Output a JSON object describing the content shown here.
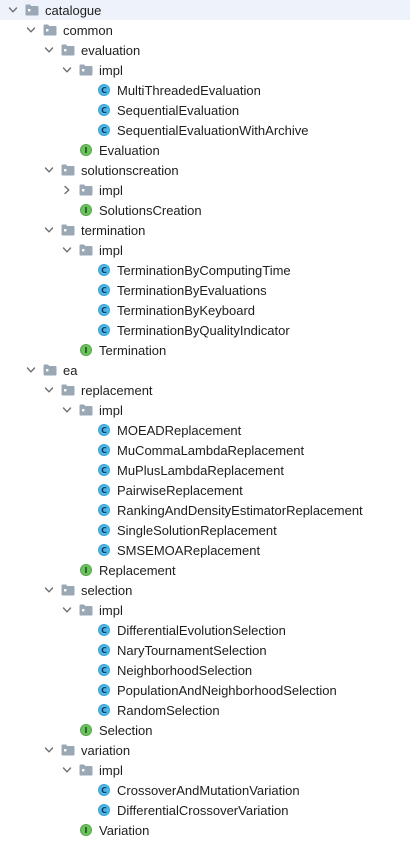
{
  "tree": [
    {
      "label": "catalogue",
      "depth": 0,
      "kind": "folder",
      "expanded": true
    },
    {
      "label": "common",
      "depth": 1,
      "kind": "folder",
      "expanded": true
    },
    {
      "label": "evaluation",
      "depth": 2,
      "kind": "folder",
      "expanded": true
    },
    {
      "label": "impl",
      "depth": 3,
      "kind": "folder",
      "expanded": true
    },
    {
      "label": "MultiThreadedEvaluation",
      "depth": 4,
      "kind": "class"
    },
    {
      "label": "SequentialEvaluation",
      "depth": 4,
      "kind": "class"
    },
    {
      "label": "SequentialEvaluationWithArchive",
      "depth": 4,
      "kind": "class"
    },
    {
      "label": "Evaluation",
      "depth": 3,
      "kind": "interface"
    },
    {
      "label": "solutionscreation",
      "depth": 2,
      "kind": "folder",
      "expanded": true
    },
    {
      "label": "impl",
      "depth": 3,
      "kind": "folder",
      "expanded": false
    },
    {
      "label": "SolutionsCreation",
      "depth": 3,
      "kind": "interface"
    },
    {
      "label": "termination",
      "depth": 2,
      "kind": "folder",
      "expanded": true
    },
    {
      "label": "impl",
      "depth": 3,
      "kind": "folder",
      "expanded": true
    },
    {
      "label": "TerminationByComputingTime",
      "depth": 4,
      "kind": "class"
    },
    {
      "label": "TerminationByEvaluations",
      "depth": 4,
      "kind": "class"
    },
    {
      "label": "TerminationByKeyboard",
      "depth": 4,
      "kind": "class"
    },
    {
      "label": "TerminationByQualityIndicator",
      "depth": 4,
      "kind": "class"
    },
    {
      "label": "Termination",
      "depth": 3,
      "kind": "interface"
    },
    {
      "label": "ea",
      "depth": 1,
      "kind": "folder",
      "expanded": true
    },
    {
      "label": "replacement",
      "depth": 2,
      "kind": "folder",
      "expanded": true
    },
    {
      "label": "impl",
      "depth": 3,
      "kind": "folder",
      "expanded": true
    },
    {
      "label": "MOEADReplacement",
      "depth": 4,
      "kind": "class"
    },
    {
      "label": "MuCommaLambdaReplacement",
      "depth": 4,
      "kind": "class"
    },
    {
      "label": "MuPlusLambdaReplacement",
      "depth": 4,
      "kind": "class"
    },
    {
      "label": "PairwiseReplacement",
      "depth": 4,
      "kind": "class"
    },
    {
      "label": "RankingAndDensityEstimatorReplacement",
      "depth": 4,
      "kind": "class"
    },
    {
      "label": "SingleSolutionReplacement",
      "depth": 4,
      "kind": "class"
    },
    {
      "label": "SMSEMOAReplacement",
      "depth": 4,
      "kind": "class"
    },
    {
      "label": "Replacement",
      "depth": 3,
      "kind": "interface"
    },
    {
      "label": "selection",
      "depth": 2,
      "kind": "folder",
      "expanded": true
    },
    {
      "label": "impl",
      "depth": 3,
      "kind": "folder",
      "expanded": true
    },
    {
      "label": "DifferentialEvolutionSelection",
      "depth": 4,
      "kind": "class"
    },
    {
      "label": "NaryTournamentSelection",
      "depth": 4,
      "kind": "class"
    },
    {
      "label": "NeighborhoodSelection",
      "depth": 4,
      "kind": "class"
    },
    {
      "label": "PopulationAndNeighborhoodSelection",
      "depth": 4,
      "kind": "class"
    },
    {
      "label": "RandomSelection",
      "depth": 4,
      "kind": "class"
    },
    {
      "label": "Selection",
      "depth": 3,
      "kind": "interface"
    },
    {
      "label": "variation",
      "depth": 2,
      "kind": "folder",
      "expanded": true
    },
    {
      "label": "impl",
      "depth": 3,
      "kind": "folder",
      "expanded": true
    },
    {
      "label": "CrossoverAndMutationVariation",
      "depth": 4,
      "kind": "class"
    },
    {
      "label": "DifferentialCrossoverVariation",
      "depth": 4,
      "kind": "class"
    },
    {
      "label": "Variation",
      "depth": 3,
      "kind": "interface"
    }
  ],
  "badges": {
    "class": "C",
    "interface": "I"
  },
  "icons": {
    "folder": "folder-icon",
    "class": "class-icon",
    "interface": "interface-icon",
    "expanded": "chevron-down-icon",
    "collapsed": "chevron-right-icon"
  },
  "colors": {
    "class_badge": "#4db7e9",
    "interface_badge": "#6cc160",
    "folder": "#9aa7b4"
  }
}
